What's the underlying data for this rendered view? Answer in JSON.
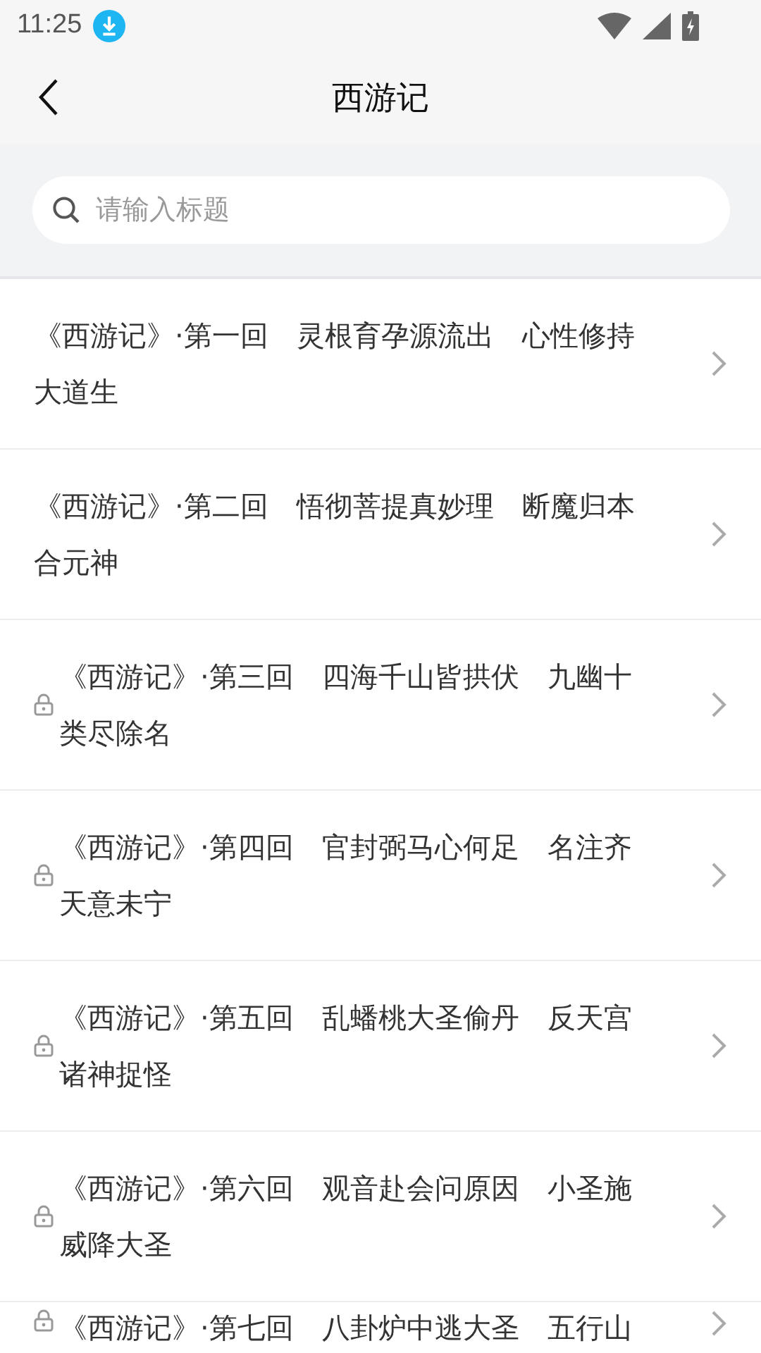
{
  "status_bar": {
    "time": "11:25"
  },
  "header": {
    "title": "西游记"
  },
  "search": {
    "placeholder": "请输入标题"
  },
  "chapters": [
    {
      "title": "《西游记》·第一回　灵根育孕源流出　心性修持大道生",
      "locked": false
    },
    {
      "title": "《西游记》·第二回　悟彻菩提真妙理　断魔归本合元神",
      "locked": false
    },
    {
      "title": "《西游记》·第三回　四海千山皆拱伏　九幽十类尽除名",
      "locked": true
    },
    {
      "title": "《西游记》·第四回　官封弼马心何足　名注齐天意未宁",
      "locked": true
    },
    {
      "title": "《西游记》·第五回　乱蟠桃大圣偷丹　反天宫诸神捉怪",
      "locked": true
    },
    {
      "title": "《西游记》·第六回　观音赴会问原因　小圣施威降大圣",
      "locked": true
    },
    {
      "title": "《西游记》·第七回　八卦炉中逃大圣　五行山",
      "locked": true
    }
  ]
}
